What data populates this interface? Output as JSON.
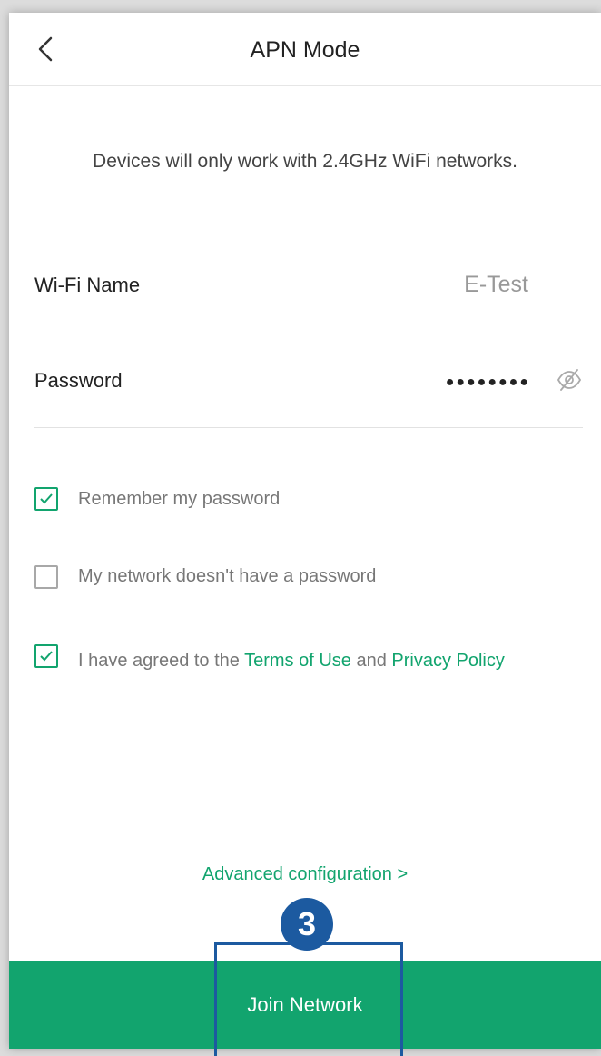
{
  "header": {
    "title": "APN Mode",
    "back_icon": "chevron-left-icon"
  },
  "notice": "Devices will only work with 2.4GHz WiFi networks.",
  "form": {
    "wifi_label": "Wi-Fi Name",
    "wifi_value": "E-Test",
    "password_label": "Password",
    "password_masked": "●●●●●●●●",
    "password_toggle_icon": "eye-off-icon"
  },
  "options": {
    "remember": {
      "label": "Remember my password",
      "checked": true
    },
    "no_password": {
      "label": "My network doesn't have a password",
      "checked": false
    },
    "terms": {
      "prefix": "I have agreed to the ",
      "terms_link": "Terms of Use",
      "middle": " and ",
      "privacy_link": "Privacy Policy",
      "checked": true
    }
  },
  "advanced_link": "Advanced configuration >",
  "join_button": "Join Network",
  "annotation": {
    "step_number": "3"
  },
  "colors": {
    "accent": "#12a46e",
    "annotation": "#1c5aa0"
  }
}
